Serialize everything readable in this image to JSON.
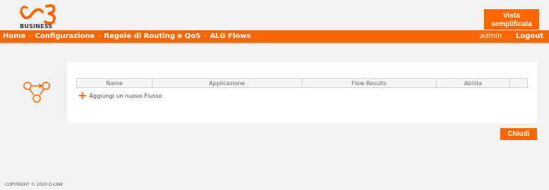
{
  "brand": {
    "name": "BUSINESS",
    "logo_icon": "windtre-logo-icon",
    "accent": "#ff6600"
  },
  "header": {
    "simple_view_line1": "Vista",
    "simple_view_line2": "semplificata"
  },
  "nav": {
    "breadcrumbs": [
      "Home",
      "Configurazione",
      "Regole di Routing e QoS",
      "ALG Flows"
    ],
    "separator": "–",
    "user": "admin",
    "logout": "Logout"
  },
  "table": {
    "columns": [
      "Name",
      "Applicazione",
      "Flow Results",
      "Abilita",
      ""
    ]
  },
  "add_flow": {
    "icon": "plus-icon",
    "label": "Aggiungi un nuovo Flusso"
  },
  "actions": {
    "close": "Chiudi"
  },
  "footer": {
    "copyright": "COPYRIGHT © 2020 D-LINK"
  }
}
